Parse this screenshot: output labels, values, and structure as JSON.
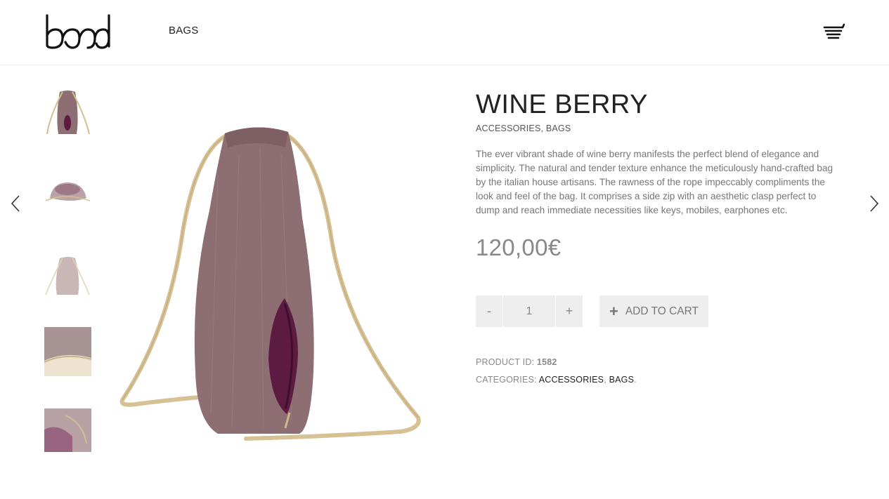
{
  "header": {
    "logo_text": "band",
    "nav": {
      "bags": "BAGS"
    },
    "cart_icon": "cart-icon"
  },
  "gallery": {
    "prev_icon": "chevron-left-icon",
    "next_icon": "chevron-right-icon",
    "thumbnail_count": 5
  },
  "product": {
    "title": "WINE BERRY",
    "categories": [
      "ACCESSORIES",
      "BAGS"
    ],
    "description": "The ever vibrant shade of wine berry manifests the perfect blend of elegance and simplicity. The natural and tender texture enhance the meticulously hand-crafted bag by the italian house artisans. The rawness of the rope impeccably compliments the look and feel of the bag. It comprises a side zip with an aesthetic clasp perfect to dump and reach immediate necessities like keys, mobiles, earphones etc.",
    "price": "120,00€",
    "quantity": "1",
    "qty_minus": "-",
    "qty_plus": "+",
    "add_to_cart": "ADD TO CART",
    "product_id_label": "PRODUCT ID:",
    "product_id": "1582",
    "categories_label": "CATEGORIES:",
    "categories_end": "."
  },
  "colors": {
    "bag": "#8a6a6f",
    "lining": "#6b1f4a",
    "rope": "#d9c49a",
    "button_bg": "#eeeeee"
  }
}
